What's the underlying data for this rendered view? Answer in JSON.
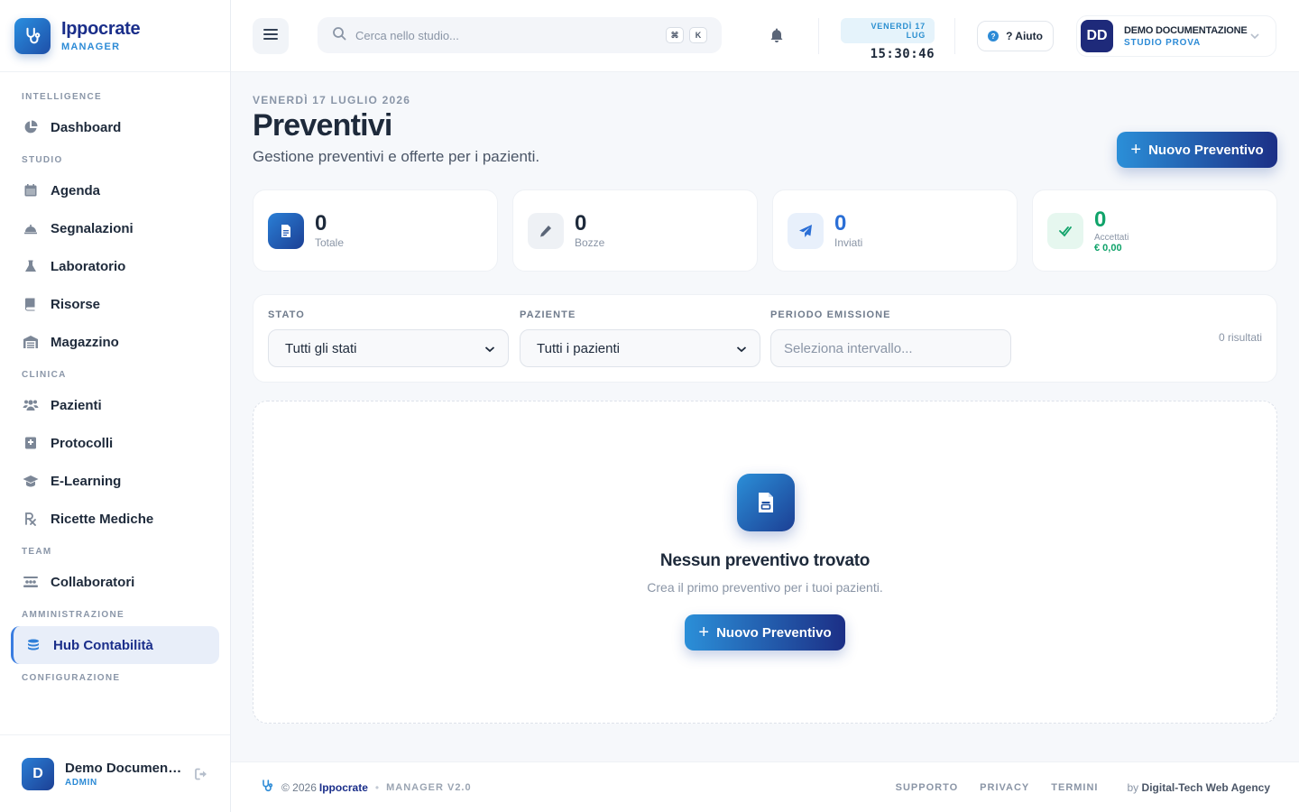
{
  "brand": {
    "name": "Ippocrate",
    "sub": "MANAGER"
  },
  "sidebar": {
    "sections": [
      {
        "title": "INTELLIGENCE",
        "items": [
          {
            "label": "Dashboard",
            "icon": "chart-pie-icon"
          }
        ]
      },
      {
        "title": "STUDIO",
        "items": [
          {
            "label": "Agenda",
            "icon": "calendar-icon"
          },
          {
            "label": "Segnalazioni",
            "icon": "bell-concierge-icon"
          },
          {
            "label": "Laboratorio",
            "icon": "flask-icon"
          },
          {
            "label": "Risorse",
            "icon": "book-icon"
          },
          {
            "label": "Magazzino",
            "icon": "warehouse-icon"
          }
        ]
      },
      {
        "title": "CLINICA",
        "items": [
          {
            "label": "Pazienti",
            "icon": "users-icon"
          },
          {
            "label": "Protocolli",
            "icon": "protocol-book-icon"
          },
          {
            "label": "E-Learning",
            "icon": "graduation-cap-icon"
          },
          {
            "label": "Ricette Mediche",
            "icon": "prescription-icon"
          }
        ]
      },
      {
        "title": "TEAM",
        "items": [
          {
            "label": "Collaboratori",
            "icon": "people-group-icon"
          }
        ]
      },
      {
        "title": "AMMINISTRAZIONE",
        "items": [
          {
            "label": "Hub Contabilità",
            "icon": "coins-icon",
            "active": true
          }
        ]
      },
      {
        "title": "CONFIGURAZIONE",
        "items": []
      }
    ],
    "user": {
      "initial": "D",
      "name": "Demo Documentazione",
      "role": "ADMIN"
    }
  },
  "header": {
    "search_placeholder": "Cerca nello studio...",
    "kbd": [
      "⌘",
      "K"
    ],
    "date_pill": "VENERDÌ 17 LUG",
    "time": "15:30:46",
    "help_label": "? Aiuto",
    "account": {
      "initials": "DD",
      "name": "DEMO DOCUMENTAZIONE",
      "sub": "STUDIO PROVA"
    }
  },
  "page": {
    "date": "VENERDÌ 17 LUGLIO 2026",
    "title": "Preventivi",
    "subtitle": "Gestione preventivi e offerte per i pazienti.",
    "new_button": "Nuovo Preventivo"
  },
  "stats": [
    {
      "value": "0",
      "label": "Totale",
      "color": "#1e2a3b",
      "icon": "document-icon"
    },
    {
      "value": "0",
      "label": "Bozze",
      "color": "#1e2a3b",
      "icon": "pencil-icon"
    },
    {
      "value": "0",
      "label": "Inviati",
      "color": "#2b6fd6",
      "icon": "paper-plane-icon"
    },
    {
      "value": "0",
      "label": "Accettati",
      "amount": "€ 0,00",
      "color": "#10a36a",
      "icon": "check-double-icon"
    }
  ],
  "filters": {
    "stato": {
      "label": "STATO",
      "value": "Tutti gli stati"
    },
    "paziente": {
      "label": "PAZIENTE",
      "value": "Tutti i pazienti"
    },
    "periodo": {
      "label": "PERIODO EMISSIONE",
      "placeholder": "Seleziona intervallo..."
    },
    "results": "0 risultati"
  },
  "empty": {
    "title": "Nessun preventivo trovato",
    "subtitle": "Crea il primo preventivo per i tuoi pazienti.",
    "button": "Nuovo Preventivo"
  },
  "footer": {
    "copyright": "© 2026",
    "brand": "Ippocrate",
    "version": "MANAGER V2.0",
    "links": [
      "SUPPORTO",
      "PRIVACY",
      "TERMINI"
    ],
    "by": "by",
    "agency": "Digital-Tech Web Agency"
  },
  "colors": {
    "accent": "#2d8bd6",
    "brand": "#1a2e8a",
    "success": "#10a36a"
  }
}
